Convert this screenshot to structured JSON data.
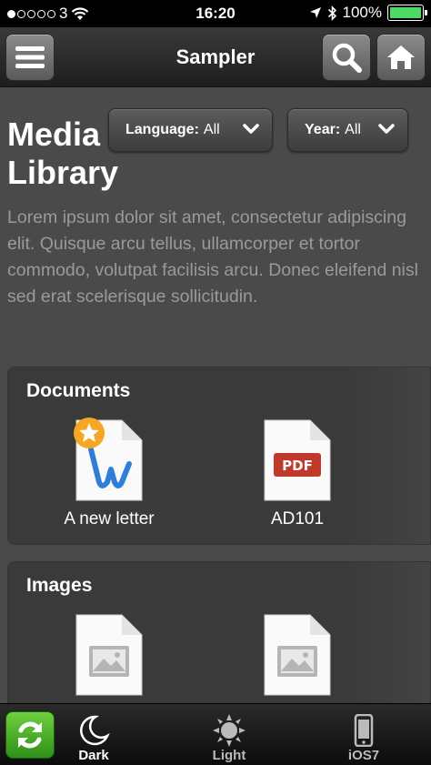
{
  "status": {
    "carrier": "3",
    "time": "16:20",
    "battery": "100%",
    "battery_level": 1.0,
    "signal_bars": 1
  },
  "header": {
    "title": "Sampler",
    "icons": [
      "menu-icon",
      "search-icon",
      "home-icon"
    ]
  },
  "page": {
    "title": "Media Library",
    "description": "Lorem ipsum dolor sit amet, consectetur adipiscing elit. Quisque arcu tellus, ullamcorper et tortor commodo, volutpat facilisis arcu. Donec eleifend nisl sed erat scelerisque sollicitudin."
  },
  "filters": {
    "language": {
      "label": "Language:",
      "value": "All"
    },
    "year": {
      "label": "Year:",
      "value": "All"
    }
  },
  "sections": {
    "documents": {
      "title": "Documents",
      "items": [
        {
          "label": "A new letter",
          "icon": "word-document-icon",
          "starred": true
        },
        {
          "label": "AD101",
          "icon": "pdf-document-icon",
          "badge": "PDF"
        }
      ]
    },
    "images": {
      "title": "Images",
      "items": [
        {
          "icon": "image-file-icon"
        },
        {
          "icon": "image-file-icon"
        }
      ]
    }
  },
  "tabbar": {
    "tabs": [
      {
        "label": "Dark",
        "icon": "moon-icon",
        "active": true
      },
      {
        "label": "Light",
        "icon": "sun-icon",
        "active": false
      },
      {
        "label": "iOS7",
        "icon": "phone-icon",
        "active": false
      }
    ]
  },
  "colors": {
    "accent_green": "#4cd964",
    "refresh_green": "#3aa520",
    "pdf_red": "#c0392b",
    "star_orange": "#f5a623",
    "word_blue": "#2f7ed8"
  }
}
